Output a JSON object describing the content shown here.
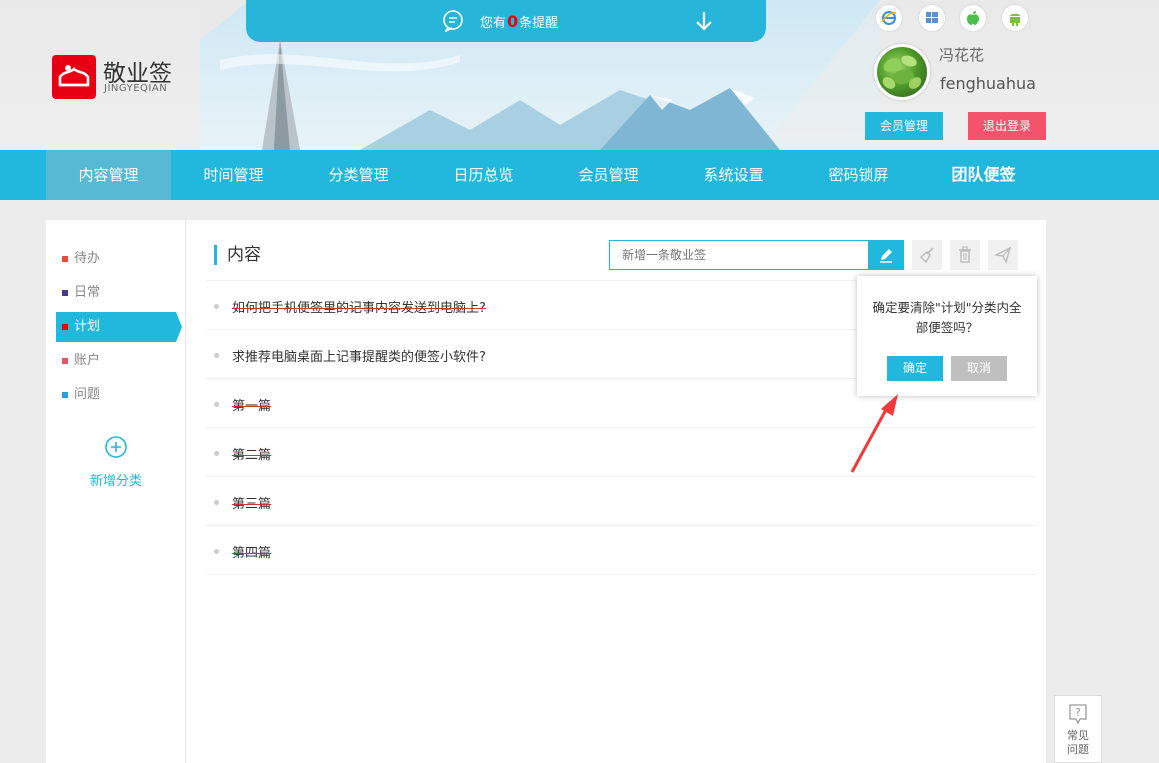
{
  "reminder": {
    "prefix": "您有",
    "count": "0",
    "suffix": "条提醒"
  },
  "brand": {
    "name": "敬业签",
    "sub": "JINGYEQIAN"
  },
  "platforms": [
    "ie-icon",
    "windows-icon",
    "apple-icon",
    "android-icon"
  ],
  "user": {
    "name_cn": "冯花花",
    "name_en": "fenghuahua"
  },
  "header_buttons": {
    "member": "会员管理",
    "logout": "退出登录"
  },
  "nav": [
    "内容管理",
    "时间管理",
    "分类管理",
    "日历总览",
    "会员管理",
    "系统设置",
    "密码锁屏",
    "团队便签"
  ],
  "sidebar": {
    "categories": [
      {
        "label": "待办",
        "color": "#e84c3d"
      },
      {
        "label": "日常",
        "color": "#4a3a8a"
      },
      {
        "label": "计划",
        "color": "#e60012"
      },
      {
        "label": "账户",
        "color": "#e8556a"
      },
      {
        "label": "问题",
        "color": "#2a9fd6"
      }
    ],
    "add_label": "新增分类"
  },
  "content": {
    "title": "内容",
    "input_placeholder": "新增一条敬业签",
    "notes": [
      {
        "text": "如何把手机便签里的记事内容发送到电脑上?",
        "done": true
      },
      {
        "text": "求推荐电脑桌面上记事提醒类的便签小软件?",
        "done": false
      },
      {
        "text": "第一篇",
        "done": true
      },
      {
        "text": "第二篇",
        "done": true
      },
      {
        "text": "第三篇",
        "done": true
      },
      {
        "text": "第四篇",
        "done": true
      }
    ]
  },
  "popup": {
    "message": "确定要清除\"计划\"分类内全部便签吗？",
    "ok": "确定",
    "cancel": "取消"
  },
  "help": {
    "line1": "常见",
    "line2": "问题"
  },
  "colors": {
    "accent": "#22b8de",
    "danger": "#f2546b",
    "brand": "#e60012"
  }
}
